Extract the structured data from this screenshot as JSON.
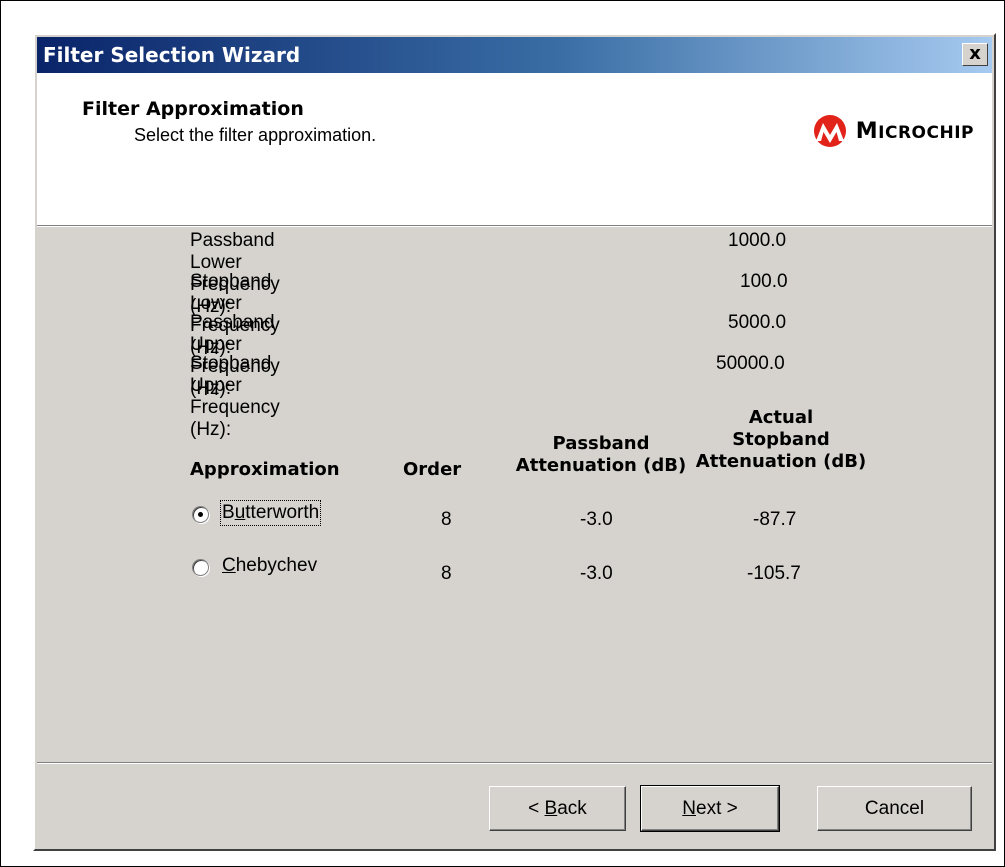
{
  "window": {
    "title": "Filter Selection Wizard",
    "close_label": "x"
  },
  "header": {
    "title": "Filter Approximation",
    "subtitle": "Select the filter approximation.",
    "logo_text": "Microchip",
    "logo_color": "#e2231a"
  },
  "frequencies": [
    {
      "label": "Passband Lower Frequency (Hz):",
      "value": "1000.0"
    },
    {
      "label": "Stopband Lower Frequency (Hz):",
      "value": "100.0"
    },
    {
      "label": "Passband Upper Frequency (Hz):",
      "value": "5000.0"
    },
    {
      "label": "Stopband Upper Frequency (Hz):",
      "value": "50000.0"
    }
  ],
  "table": {
    "headers": {
      "approximation": "Approximation",
      "order": "Order",
      "passband_line1": "Passband",
      "passband_line2": "Attenuation (dB)",
      "stopband_line1": "Actual",
      "stopband_line2": "Stopband",
      "stopband_line3": "Attenuation (dB)"
    },
    "rows": [
      {
        "name_first": "B",
        "name_u": "u",
        "name_rest": "tterworth",
        "order": "8",
        "passband": "-3.0",
        "stopband": "-87.7",
        "selected": true
      },
      {
        "name_first": "",
        "name_u": "C",
        "name_rest": "hebychev",
        "order": "8",
        "passband": "-3.0",
        "stopband": "-105.7",
        "selected": false
      }
    ]
  },
  "buttons": {
    "back_prefix": "< ",
    "back_u": "B",
    "back_rest": "ack",
    "next_u": "N",
    "next_rest": "ext >",
    "cancel": "Cancel"
  }
}
